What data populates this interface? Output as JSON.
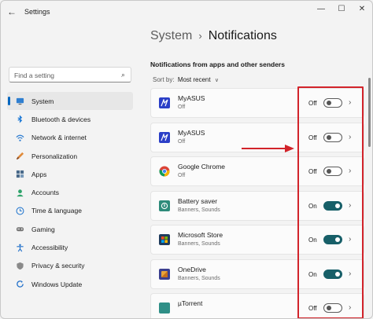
{
  "window": {
    "title": "Settings",
    "back_icon": "back-arrow-icon",
    "minimize_glyph": "—",
    "maximize_glyph": "☐",
    "close_glyph": "✕"
  },
  "search": {
    "placeholder": "Find a setting",
    "icon": "search-icon"
  },
  "sidebar": {
    "items": [
      {
        "label": "System",
        "icon": "monitor-icon",
        "active": true
      },
      {
        "label": "Bluetooth & devices",
        "icon": "bluetooth-icon"
      },
      {
        "label": "Network & internet",
        "icon": "wifi-icon"
      },
      {
        "label": "Personalization",
        "icon": "brush-icon"
      },
      {
        "label": "Apps",
        "icon": "apps-icon"
      },
      {
        "label": "Accounts",
        "icon": "person-icon"
      },
      {
        "label": "Time & language",
        "icon": "globe-clock-icon"
      },
      {
        "label": "Gaming",
        "icon": "gamepad-icon"
      },
      {
        "label": "Accessibility",
        "icon": "accessibility-icon"
      },
      {
        "label": "Privacy & security",
        "icon": "shield-icon"
      },
      {
        "label": "Windows Update",
        "icon": "update-icon"
      }
    ]
  },
  "breadcrumb": {
    "parent": "System",
    "separator": "›",
    "current": "Notifications"
  },
  "section_title": "Notifications from apps and other senders",
  "sort": {
    "label": "Sort by:",
    "value": "Most recent"
  },
  "apps": [
    {
      "name": "MyASUS",
      "sub": "Off",
      "state": "Off",
      "on": false,
      "icon": "myasus-icon",
      "color": "#2b3fc7"
    },
    {
      "name": "MyASUS",
      "sub": "Off",
      "state": "Off",
      "on": false,
      "icon": "myasus-icon",
      "color": "#2b3fc7"
    },
    {
      "name": "Google Chrome",
      "sub": "Off",
      "state": "Off",
      "on": false,
      "icon": "chrome-icon",
      "color": "#db4437"
    },
    {
      "name": "Battery saver",
      "sub": "Banners, Sounds",
      "state": "On",
      "on": true,
      "icon": "battery-saver-icon",
      "color": "#2e8b7a"
    },
    {
      "name": "Microsoft Store",
      "sub": "Banners, Sounds",
      "state": "On",
      "on": true,
      "icon": "store-icon",
      "color": "#1f3b5c"
    },
    {
      "name": "OneDrive",
      "sub": "Banners, Sounds",
      "state": "On",
      "on": true,
      "icon": "onedrive-icon",
      "color": "#3b3f8f"
    },
    {
      "name": "µTorrent",
      "sub": "",
      "state": "Off",
      "on": false,
      "icon": "utorrent-icon",
      "color": "#2f8f87"
    }
  ],
  "colors": {
    "accent": "#0067c0",
    "toggle_on": "#175f68",
    "annotation": "#d2232a"
  }
}
